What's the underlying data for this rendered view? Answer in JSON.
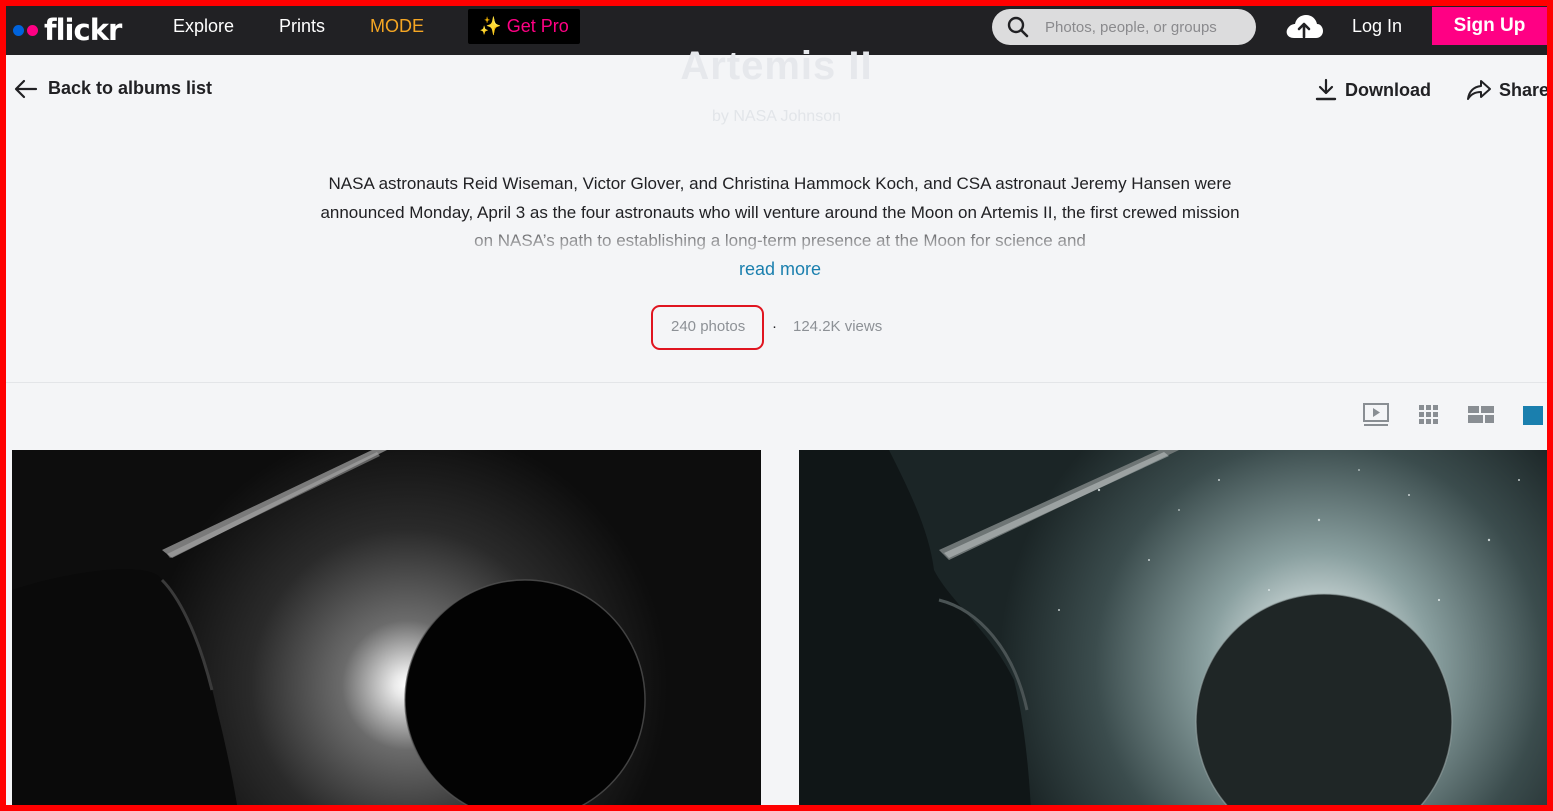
{
  "nav": {
    "logo": "flickr",
    "links": {
      "explore": "Explore",
      "prints": "Prints",
      "mode": "MODE"
    },
    "get_pro": "Get Pro",
    "search_placeholder": "Photos, people, or groups",
    "login": "Log In",
    "signup": "Sign Up",
    "colors": {
      "bar": "#212124",
      "blue_dot": "#0063dc",
      "pink_dot": "#ff0084",
      "mode": "#f5a623"
    }
  },
  "album": {
    "title": "Artemis II",
    "by_line": "by NASA Johnson",
    "description": "NASA astronauts Reid Wiseman, Victor Glover, and Christina Hammock Koch, and CSA astronaut Jeremy Hansen were announced Monday, April 3 as the four astronauts who will venture around the Moon on Artemis II, the first crewed mission on NASA’s path to establishing a long-term presence at the Moon for science and",
    "read_more": "read more",
    "photo_count": "240 photos",
    "views": "124.2K views"
  },
  "actions": {
    "back": "Back to albums list",
    "download": "Download",
    "share": "Share"
  },
  "view_modes": [
    "slideshow-icon",
    "grid-icon",
    "justified-icon",
    "single-icon"
  ],
  "icons": {
    "back": "arrow-left-icon",
    "download": "download-icon",
    "share": "share-arrow-icon",
    "search": "search-icon",
    "upload": "cloud-upload-icon",
    "sparkle": "sparkle-icon"
  },
  "photos": [
    {
      "alt": "Spacecraft solar array silhouetted against a dark eclipsed Moon with bright sun glow"
    },
    {
      "alt": "Spacecraft solar array with the Moon backlit by a bright halo and stars"
    }
  ]
}
